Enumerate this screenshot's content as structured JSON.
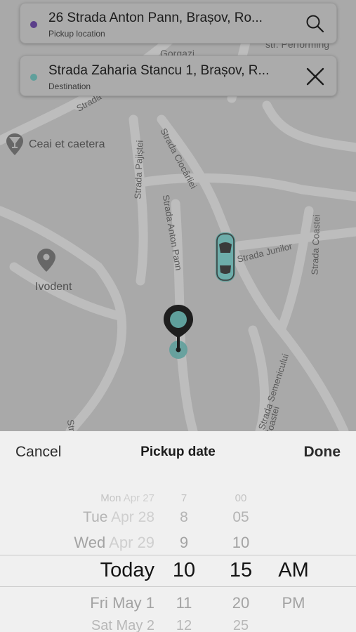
{
  "map": {
    "streets": [
      "Strada Pajiștei",
      "Strada Ciocârliei",
      "Strada Anton Pann",
      "Strada Junilor",
      "Strada Coastei",
      "Strada Semenicului",
      "Strada",
      "Strada",
      "Coastei"
    ],
    "pois": [
      {
        "name": "Ceai et caetera",
        "icon": "cafe-pin-icon"
      },
      {
        "name": "Ivodent",
        "icon": "location-pin-icon"
      }
    ],
    "partial_labels": [
      "Gorgazi",
      "str. Performing"
    ],
    "car_icon": "car-icon",
    "marker_icon": "pickup-marker-icon"
  },
  "pickup": {
    "address": "26 Strada Anton Pann, Brașov, Ro...",
    "label": "Pickup location",
    "dot_color": "#5b3f8a",
    "action_icon": "search-icon"
  },
  "destination": {
    "address": "Strada Zaharia Stancu 1, Brașov, R...",
    "label": "Destination",
    "dot_color": "#5f9f9b",
    "action_icon": "close-icon"
  },
  "toolbar": {
    "cancel": "Cancel",
    "title": "Pickup date",
    "done": "Done"
  },
  "picker": {
    "days": [
      {
        "weekday": "Mon",
        "date": "Apr 27"
      },
      {
        "weekday": "Tue",
        "date": "Apr 28"
      },
      {
        "weekday": "Wed",
        "date": "Apr 29"
      },
      {
        "weekday": "",
        "date": "Today"
      },
      {
        "weekday": "Fri",
        "date": "May 1"
      },
      {
        "weekday": "Sat",
        "date": "May 2"
      }
    ],
    "hours": [
      "7",
      "8",
      "9",
      "10",
      "11",
      "12"
    ],
    "minutes": [
      "00",
      "05",
      "10",
      "15",
      "20",
      "25"
    ],
    "ampm": [
      "AM",
      "PM"
    ],
    "selected": {
      "day": "Today",
      "hour": "10",
      "minute": "15",
      "period": "AM"
    }
  }
}
